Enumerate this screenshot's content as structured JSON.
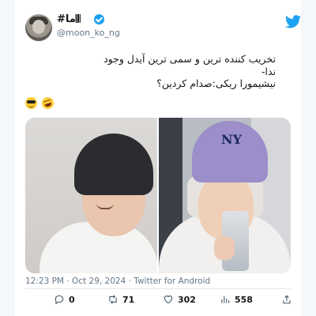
{
  "author": {
    "display_name": "#ﻣﺎ𝄃𝄃",
    "handle": "@moon_ko_ng",
    "verified_icon": "verified-badge-icon"
  },
  "brand": {
    "icon": "twitter-bird-icon",
    "color": "#1da1f2"
  },
  "tweet": {
    "lines": [
      "تخریب کننده ترین و سمی ترین آیدل وجود",
      "ندا-",
      "نیشیمورا ریکی:صدام کردین؟"
    ],
    "emojis": [
      "smiling-face-with-sunglasses",
      "rolling-on-the-floor-laughing"
    ]
  },
  "media": {
    "images": [
      {
        "name": "photo-left",
        "description_icon": "photo"
      },
      {
        "name": "photo-right",
        "cap_logo": "NY"
      }
    ]
  },
  "meta": {
    "time": "12:23 PM",
    "separator": " · ",
    "date": "Oct 29, 2024",
    "source": "Twitter for Android"
  },
  "actions": {
    "reply": {
      "icon": "reply-icon",
      "count": "0"
    },
    "retweet": {
      "icon": "retweet-icon",
      "count": "71"
    },
    "like": {
      "icon": "heart-icon",
      "count": "302"
    },
    "views": {
      "icon": "views-icon",
      "count": "558"
    },
    "share": {
      "icon": "share-icon"
    }
  }
}
